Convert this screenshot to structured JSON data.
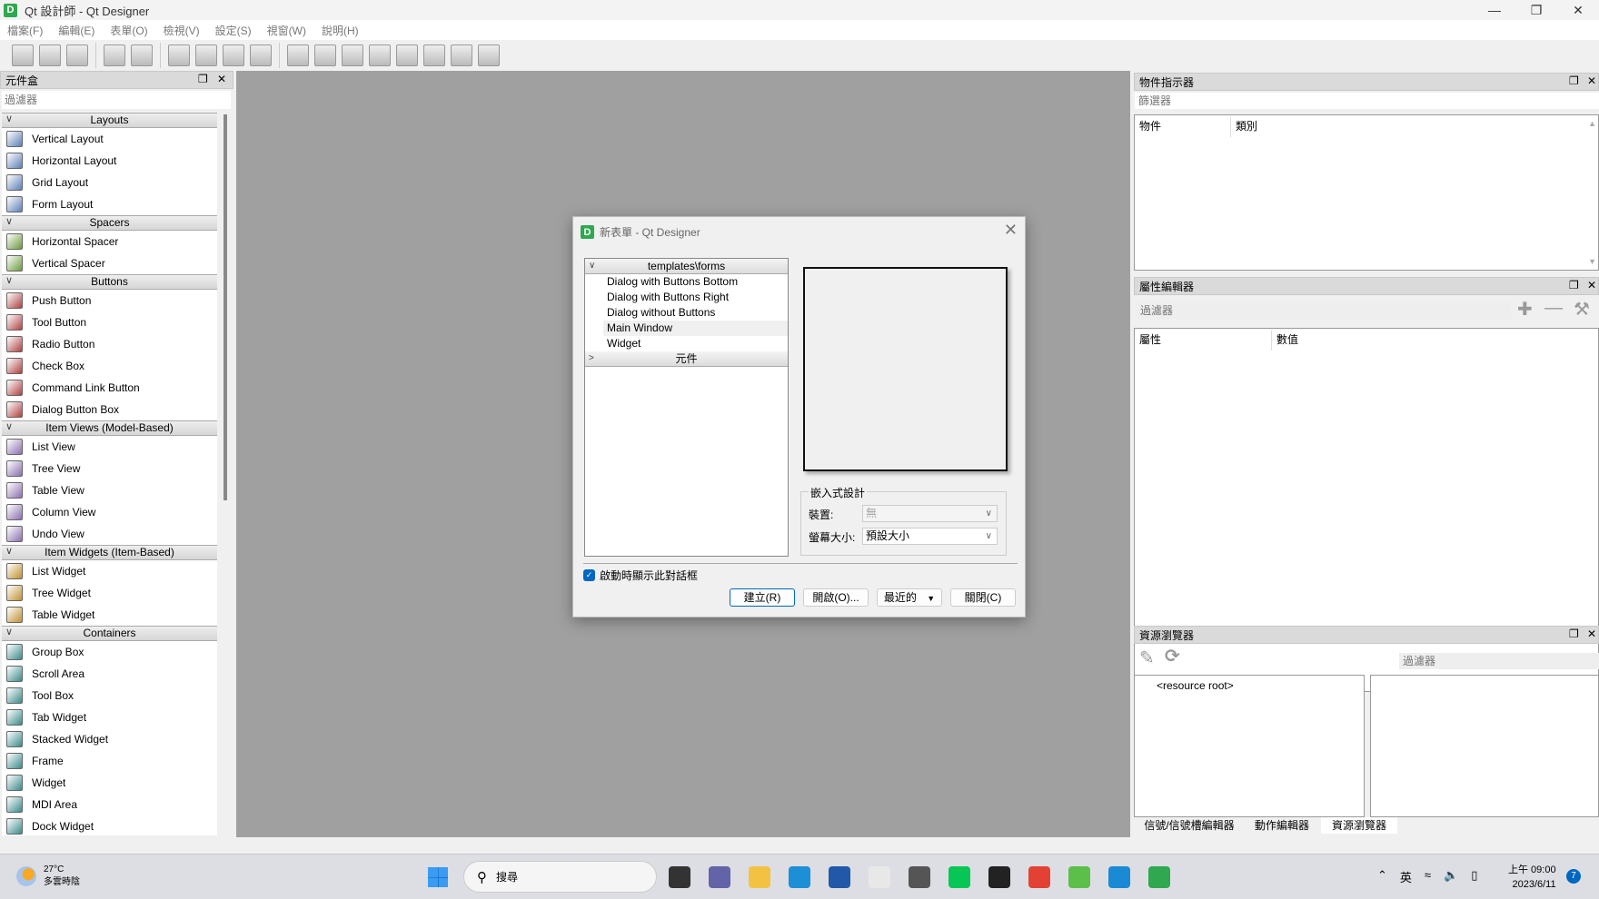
{
  "window": {
    "title": "Qt 設計師 - Qt Designer",
    "logo": "D"
  },
  "menu": [
    "檔案(F)",
    "編輯(E)",
    "表單(O)",
    "檢視(V)",
    "設定(S)",
    "視窗(W)",
    "說明(H)"
  ],
  "toolbar_icons": [
    "new-file-icon",
    "open-folder-icon",
    "save-icon",
    "|",
    "send-to-back-icon",
    "bring-to-front-icon",
    "|",
    "edit-widgets-icon",
    "edit-signals-slots-icon",
    "edit-buddies-icon",
    "edit-tab-order-icon",
    "|",
    "layout-horizontal-icon",
    "layout-vertical-icon",
    "layout-horizontal-splitter-icon",
    "layout-vertical-splitter-icon",
    "layout-grid-icon",
    "layout-form-icon",
    "break-layout-icon",
    "adjust-size-icon"
  ],
  "widget_box": {
    "title": "元件盒",
    "filter_placeholder": "過濾器",
    "categories": [
      {
        "name": "Layouts",
        "items": [
          "Vertical Layout",
          "Horizontal Layout",
          "Grid Layout",
          "Form Layout"
        ]
      },
      {
        "name": "Spacers",
        "items": [
          "Horizontal Spacer",
          "Vertical Spacer"
        ]
      },
      {
        "name": "Buttons",
        "items": [
          "Push Button",
          "Tool Button",
          "Radio Button",
          "Check Box",
          "Command Link Button",
          "Dialog Button Box"
        ]
      },
      {
        "name": "Item Views (Model-Based)",
        "items": [
          "List View",
          "Tree View",
          "Table View",
          "Column View",
          "Undo View"
        ]
      },
      {
        "name": "Item Widgets (Item-Based)",
        "items": [
          "List Widget",
          "Tree Widget",
          "Table Widget"
        ]
      },
      {
        "name": "Containers",
        "items": [
          "Group Box",
          "Scroll Area",
          "Tool Box",
          "Tab Widget",
          "Stacked Widget",
          "Frame",
          "Widget",
          "MDI Area",
          "Dock Widget"
        ]
      }
    ]
  },
  "dialog": {
    "title": "新表單 - Qt Designer",
    "tree_category": "templates\\forms",
    "templates": [
      "Dialog with Buttons Bottom",
      "Dialog with Buttons Right",
      "Dialog without Buttons",
      "Main Window",
      "Widget"
    ],
    "selected_template": "Main Window",
    "widgets_category": "元件",
    "embedded_label": "嵌入式設計",
    "device_label": "裝置:",
    "device_value": "無",
    "screen_size_label": "螢幕大小:",
    "screen_size_value": "預設大小",
    "show_on_startup": "啟動時顯示此對話框",
    "show_on_startup_checked": true,
    "buttons": {
      "create": "建立(R)",
      "open": "開啟(O)...",
      "recent": "最近的",
      "close": "關閉(C)"
    }
  },
  "object_inspector": {
    "title": "物件指示器",
    "filter_placeholder": "篩選器",
    "columns": [
      "物件",
      "類別"
    ]
  },
  "property_editor": {
    "title": "屬性編輯器",
    "filter_placeholder": "過濾器",
    "columns": [
      "屬性",
      "數值"
    ]
  },
  "resource_browser": {
    "title": "資源瀏覽器",
    "filter_placeholder": "過濾器",
    "root": "<resource root>"
  },
  "bottom_tabs": [
    "信號/信號槽編輯器",
    "動作編輯器",
    "資源瀏覽器"
  ],
  "active_bottom_tab": "資源瀏覽器",
  "taskbar": {
    "weather_temp": "27°C",
    "weather_desc": "多雲時陰",
    "search_placeholder": "搜尋",
    "apps": [
      {
        "name": "task-view",
        "color": "#333333"
      },
      {
        "name": "teams",
        "color": "#6264a7"
      },
      {
        "name": "file-explorer",
        "color": "#f4c242"
      },
      {
        "name": "edge",
        "color": "#1d8fd6"
      },
      {
        "name": "store",
        "color": "#2159a8"
      },
      {
        "name": "snipping-tool",
        "color": "#e8e8e8"
      },
      {
        "name": "unity",
        "color": "#555555"
      },
      {
        "name": "line",
        "color": "#06c755"
      },
      {
        "name": "obs",
        "color": "#222222"
      },
      {
        "name": "chrome",
        "color": "#e34133"
      },
      {
        "name": "app-green-ring",
        "color": "#5cbf4a"
      },
      {
        "name": "vscode",
        "color": "#1a8ad4"
      },
      {
        "name": "qt-designer",
        "color": "#2fa84f"
      }
    ],
    "ime": "英",
    "time": "上午 09:00",
    "date": "2023/6/11",
    "notifications": "7"
  }
}
